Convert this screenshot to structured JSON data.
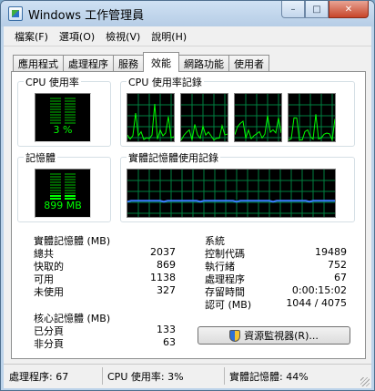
{
  "window": {
    "title": "Windows 工作管理員",
    "minimize": "–",
    "maximize": "□",
    "close": "✕"
  },
  "menu": [
    "檔案(F)",
    "選項(O)",
    "檢視(V)",
    "說明(H)"
  ],
  "tabs": [
    "應用程式",
    "處理程序",
    "服務",
    "效能",
    "網路功能",
    "使用者"
  ],
  "active_tab": 3,
  "cpu": {
    "label": "CPU 使用率",
    "value_text": "3 %",
    "percent": 3
  },
  "cpu_history": {
    "label": "CPU 使用率記錄",
    "cores": 4
  },
  "memory": {
    "label": "記憶體",
    "value_text": "899 MB",
    "percent": 22
  },
  "memory_history": {
    "label": "實體記憶體使用記錄"
  },
  "physical_memory": {
    "label": "實體記憶體 (MB)",
    "rows": [
      {
        "key": "總共",
        "value": "2037"
      },
      {
        "key": "快取的",
        "value": "869"
      },
      {
        "key": "可用",
        "value": "1138"
      },
      {
        "key": "未使用",
        "value": "327"
      }
    ]
  },
  "system": {
    "label": "系統",
    "rows": [
      {
        "key": "控制代碼",
        "value": "19489"
      },
      {
        "key": "執行緒",
        "value": "752"
      },
      {
        "key": "處理程序",
        "value": "67"
      },
      {
        "key": "存留時間",
        "value": "0:00:15:02"
      },
      {
        "key": "認可 (MB)",
        "value": "1044 / 4075"
      }
    ]
  },
  "kernel_memory": {
    "label": "核心記憶體 (MB)",
    "rows": [
      {
        "key": "已分頁",
        "value": "133"
      },
      {
        "key": "非分頁",
        "value": "63"
      }
    ]
  },
  "resource_monitor_button": "資源監視器(R)...",
  "status": {
    "processes": "處理程序: 67",
    "cpu": "CPU 使用率: 3%",
    "memory": "實體記憶體: 44%"
  },
  "colors": {
    "graph_bg": "#000000",
    "grid": "#008040",
    "cpu_line": "#00ff00",
    "mem_line": "#3b7cff"
  }
}
